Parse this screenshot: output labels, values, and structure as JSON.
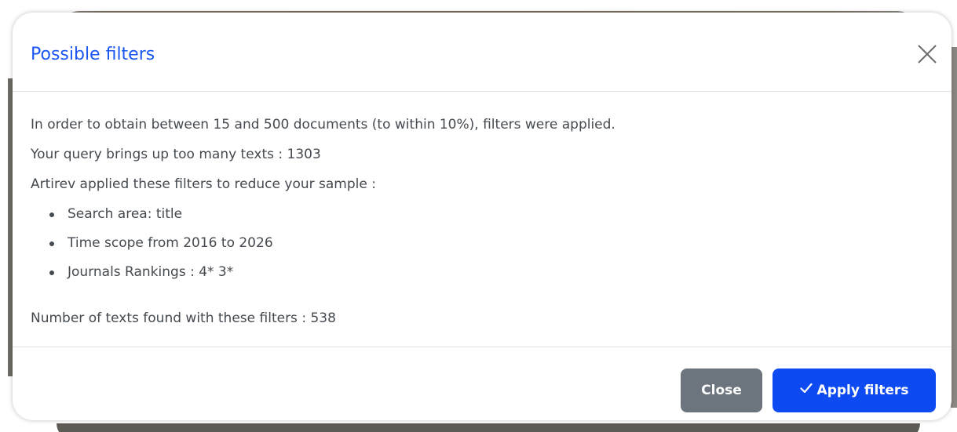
{
  "modal": {
    "title": "Possible filters",
    "body": {
      "line1": "In order to obtain between 15 and 500 documents (to within 10%), filters were applied.",
      "line2": "Your query brings up too many texts : 1303",
      "line3": "Artirev applied these filters to reduce your sample :",
      "filters": [
        "Search area: title",
        "Time scope from 2016 to 2026",
        "Journals Rankings : 4* 3*"
      ],
      "result": "Number of texts found with these filters : 538"
    },
    "footer": {
      "close_label": "Close",
      "apply_label": "Apply filters"
    }
  },
  "colors": {
    "title": "#1a56f0",
    "body_text": "#444a50",
    "close_button": "#6c757d",
    "apply_button": "#0d4af2"
  },
  "icons": {
    "dismiss": "close-x-icon",
    "apply": "checkmark-icon"
  }
}
